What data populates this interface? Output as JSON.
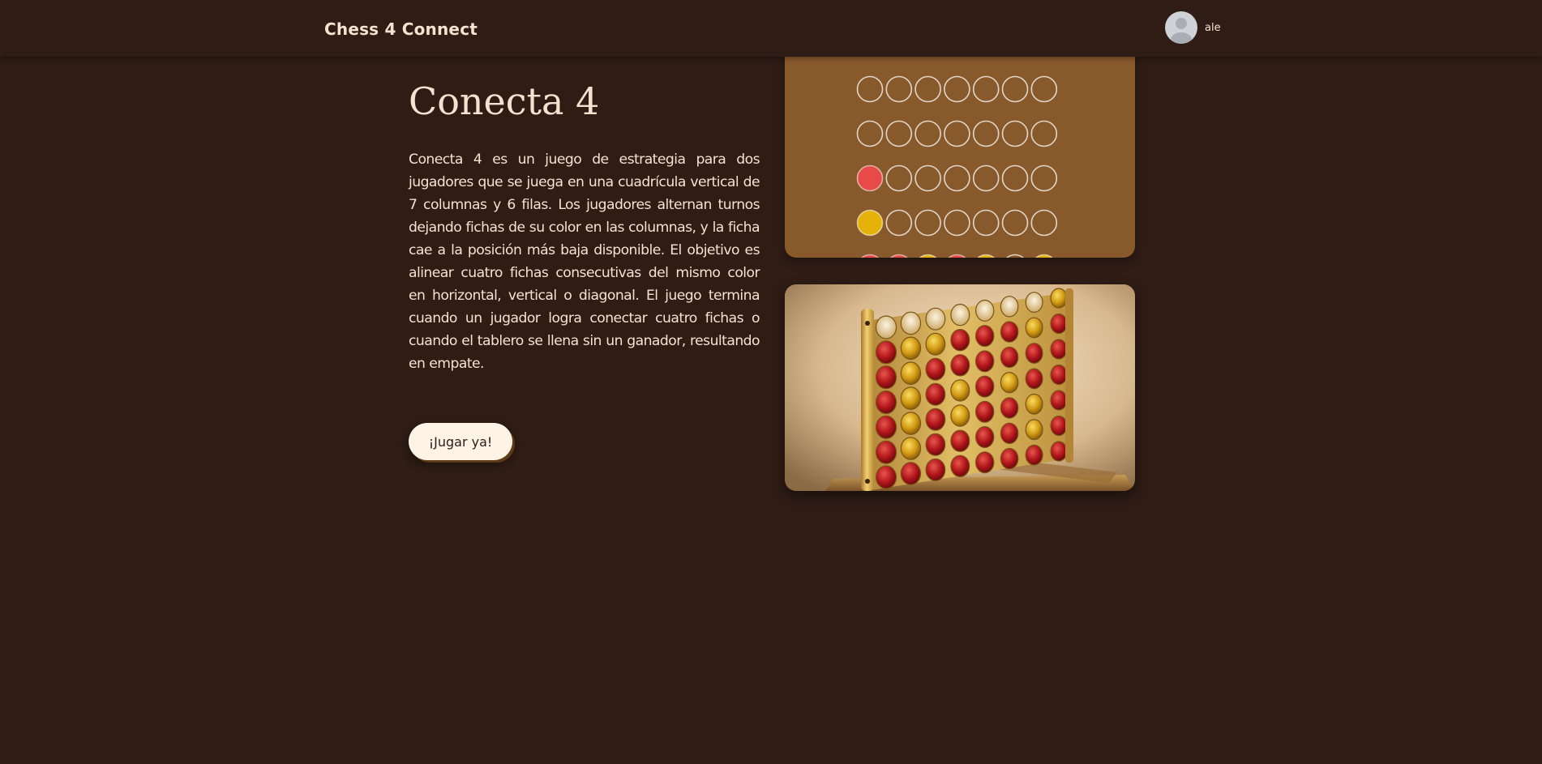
{
  "header": {
    "brand": "Chess 4 Connect",
    "username": "ale"
  },
  "hero": {
    "title": "Conecta 4",
    "description": "Conecta 4 es un juego de estrategia para dos jugadores que se juega en una cuadrícula vertical de 7 columnas y 6 filas. Los jugadores alternan turnos dejando fichas de su color en las columnas, y la ficha cae a la posición más baja disponible. El objetivo es alinear cuatro fichas consecutivas del mismo color en horizontal, vertical o diagonal. El juego termina cuando un jugador logra conectar cuatro fichas o cuando el tablero se llena sin un ganador, resultando en empate.",
    "play_button": "¡Jugar ya!"
  },
  "board": {
    "rows": [
      [
        "empty",
        "empty",
        "empty",
        "empty",
        "empty",
        "empty",
        "empty"
      ],
      [
        "empty",
        "empty",
        "empty",
        "empty",
        "empty",
        "empty",
        "empty"
      ],
      [
        "red",
        "empty",
        "empty",
        "empty",
        "empty",
        "empty",
        "empty"
      ],
      [
        "yellow",
        "empty",
        "empty",
        "empty",
        "empty",
        "empty",
        "empty"
      ],
      [
        "red",
        "red",
        "yellow",
        "red",
        "yellow",
        "empty",
        "yellow"
      ]
    ]
  },
  "colors": {
    "background": "#2e1c15",
    "text": "#f3e3cf",
    "board": "#87592b",
    "piece_red": "#e84a4a",
    "piece_yellow": "#e6b20a",
    "button_bg": "#fff3e6"
  }
}
